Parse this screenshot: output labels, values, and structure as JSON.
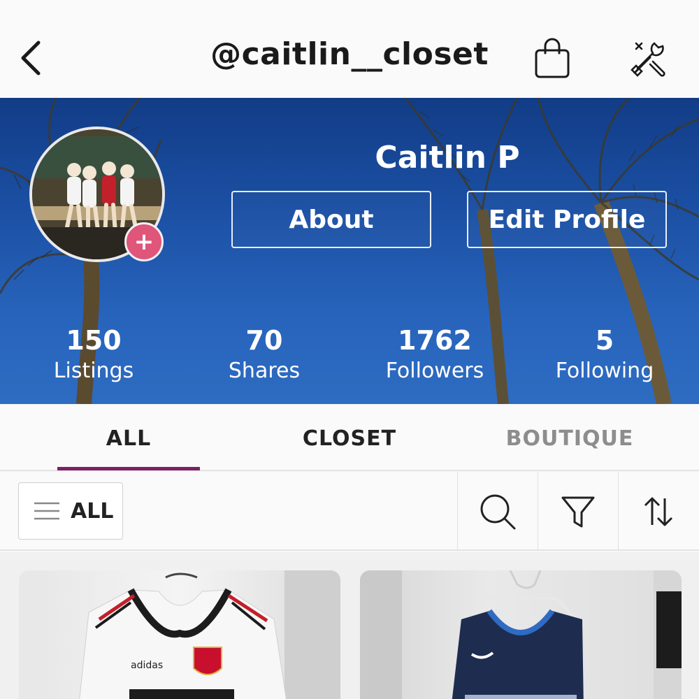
{
  "header": {
    "handle": "@caitlin__closet",
    "back_icon": "chevron-left-icon",
    "bag_icon": "shopping-bag-icon",
    "tools_icon": "tools-icon"
  },
  "profile": {
    "display_name": "Caitlin P",
    "about_label": "About",
    "edit_label": "Edit Profile",
    "add_badge": "+",
    "stats": [
      {
        "value": "150",
        "label": "Listings"
      },
      {
        "value": "70",
        "label": "Shares"
      },
      {
        "value": "1762",
        "label": "Followers"
      },
      {
        "value": "5",
        "label": "Following"
      }
    ]
  },
  "tabs": [
    {
      "label": "ALL",
      "active": true
    },
    {
      "label": "CLOSET",
      "active": false
    },
    {
      "label": "BOUTIQUE",
      "active": false
    }
  ],
  "filters": {
    "category_label": "ALL",
    "icons": [
      "search-icon",
      "filter-icon",
      "sort-icon"
    ]
  },
  "colors": {
    "accent": "#7f1f63",
    "add_badge": "#e0557a",
    "banner_sky": "#1b4fa3"
  }
}
